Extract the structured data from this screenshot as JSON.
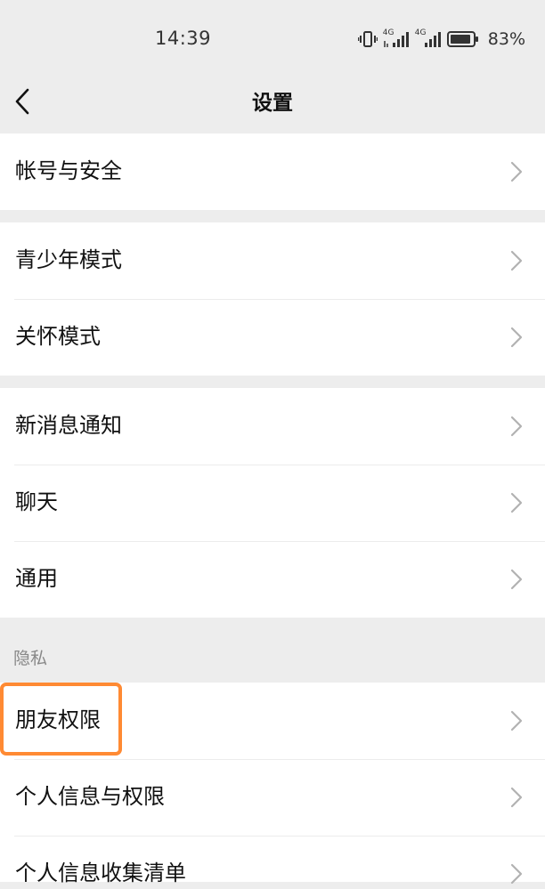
{
  "status_bar": {
    "time": "14:39",
    "battery": "83%",
    "network_label_1": "4G",
    "network_label_2": "4G",
    "icons": [
      "vibrate-icon",
      "signal-4g-icon",
      "signal-4g-icon",
      "battery-icon"
    ]
  },
  "nav": {
    "title": "设置",
    "back_icon": "chevron-left-icon"
  },
  "groups": [
    {
      "items": [
        {
          "label": "帐号与安全"
        }
      ]
    },
    {
      "items": [
        {
          "label": "青少年模式"
        },
        {
          "label": "关怀模式"
        }
      ]
    },
    {
      "items": [
        {
          "label": "新消息通知"
        },
        {
          "label": "聊天"
        },
        {
          "label": "通用"
        }
      ]
    }
  ],
  "privacy_section": {
    "header": "隐私",
    "items": [
      {
        "label": "朋友权限"
      },
      {
        "label": "个人信息与权限"
      },
      {
        "label": "个人信息收集清单"
      }
    ]
  },
  "colors": {
    "background": "#ededed",
    "card": "#ffffff",
    "highlight": "#ff8a33",
    "chevron": "#b2b2b2"
  }
}
